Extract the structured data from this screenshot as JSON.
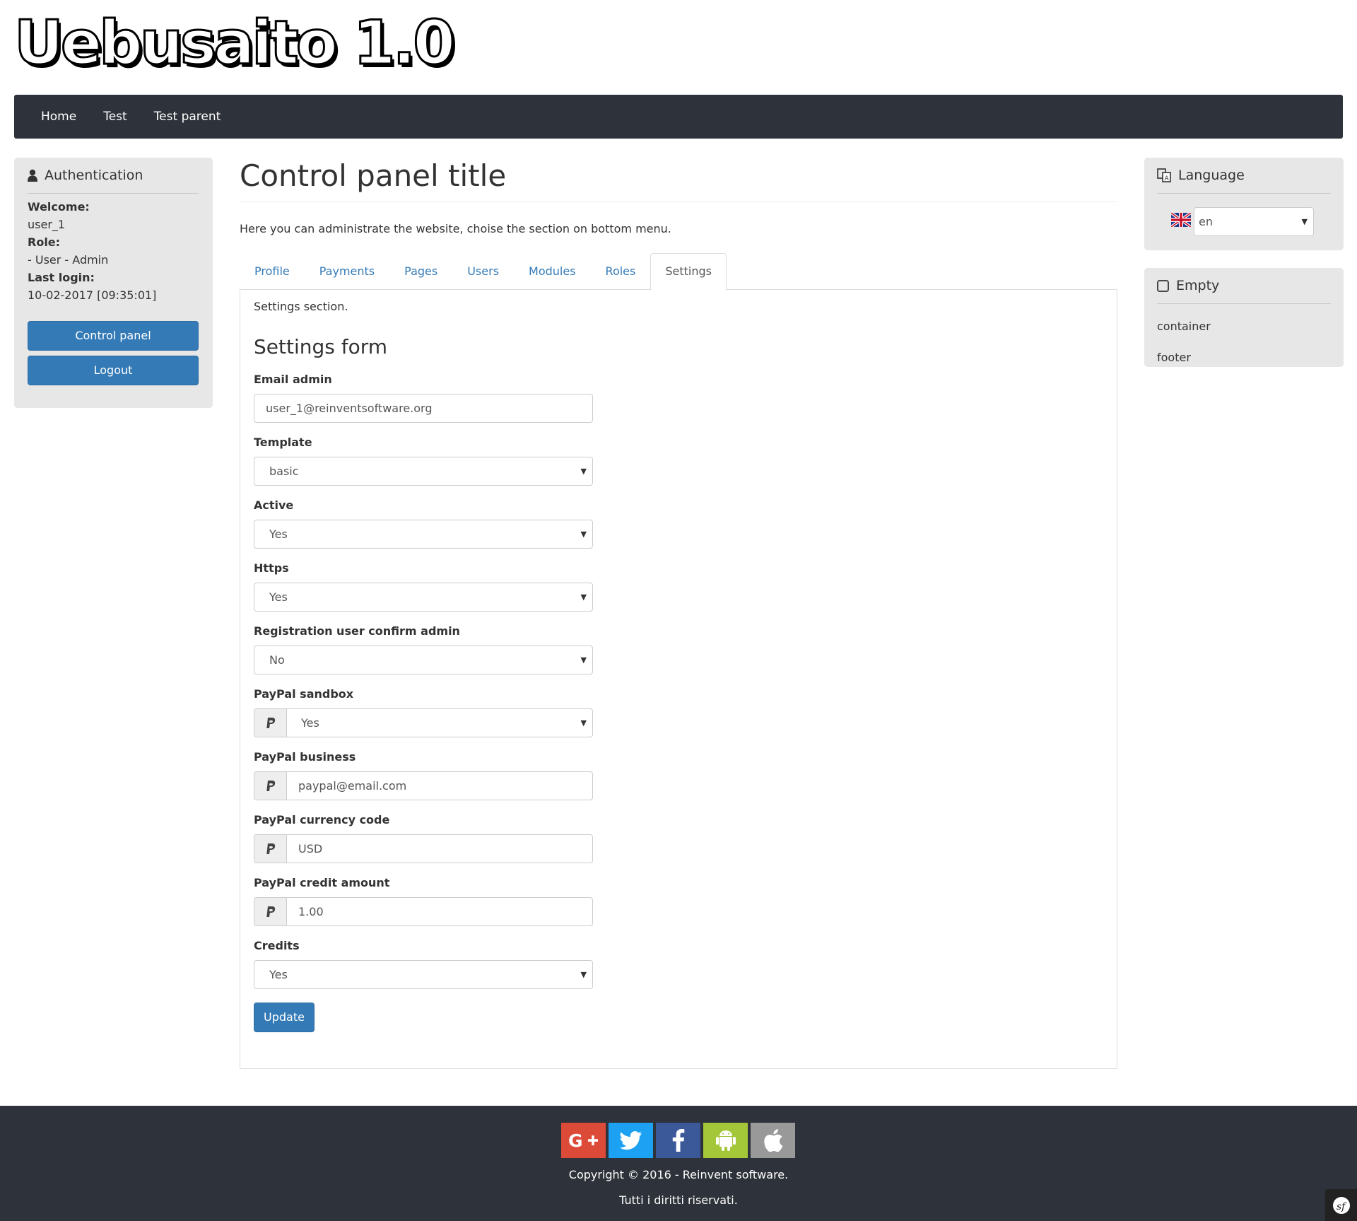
{
  "site": {
    "logo_text": "Uebusaito 1.0"
  },
  "nav": {
    "items": [
      {
        "label": "Home"
      },
      {
        "label": "Test"
      },
      {
        "label": "Test parent"
      }
    ]
  },
  "auth": {
    "title": "Authentication",
    "welcome_label": "Welcome:",
    "welcome_value": "user_1",
    "role_label": "Role:",
    "role_value": "- User - Admin",
    "last_login_label": "Last login:",
    "last_login_value": "10-02-2017 [09:35:01]",
    "control_panel_label": "Control panel",
    "logout_label": "Logout"
  },
  "main": {
    "title": "Control panel title",
    "intro": "Here you can administrate the website, choise the section on bottom menu.",
    "tabs": [
      {
        "label": "Profile"
      },
      {
        "label": "Payments"
      },
      {
        "label": "Pages"
      },
      {
        "label": "Users"
      },
      {
        "label": "Modules"
      },
      {
        "label": "Roles"
      },
      {
        "label": "Settings",
        "active": true
      }
    ],
    "section_text": "Settings section.",
    "form": {
      "title": "Settings form",
      "fields": {
        "email_admin": {
          "label": "Email admin",
          "value": "user_1@reinventsoftware.org"
        },
        "template": {
          "label": "Template",
          "value": "basic"
        },
        "active": {
          "label": "Active",
          "value": "Yes"
        },
        "https": {
          "label": "Https",
          "value": "Yes"
        },
        "registration": {
          "label": "Registration user confirm admin",
          "value": "No"
        },
        "paypal_sandbox": {
          "label": "PayPal sandbox",
          "value": "Yes"
        },
        "paypal_business": {
          "label": "PayPal business",
          "value": "paypal@email.com"
        },
        "paypal_currency": {
          "label": "PayPal currency code",
          "value": "USD"
        },
        "paypal_credit": {
          "label": "PayPal credit amount",
          "value": "1.00"
        },
        "credits": {
          "label": "Credits",
          "value": "Yes"
        }
      },
      "submit_label": "Update"
    }
  },
  "language": {
    "title": "Language",
    "selected": "en"
  },
  "empty_panel": {
    "title": "Empty",
    "items": [
      {
        "label": "container"
      },
      {
        "label": "footer"
      }
    ]
  },
  "footer": {
    "copyright": "Copyright © 2016 - Reinvent software.",
    "rights": "Tutti i diritti riservati.",
    "social": [
      {
        "name": "google-plus-icon",
        "color": "#dc4a38"
      },
      {
        "name": "twitter-icon",
        "color": "#1da1f2"
      },
      {
        "name": "facebook-icon",
        "color": "#3b5998"
      },
      {
        "name": "android-icon",
        "color": "#a4c639"
      },
      {
        "name": "apple-icon",
        "color": "#999999"
      }
    ]
  },
  "colors": {
    "navbar": "#2e323a",
    "primary": "#337ab7",
    "panel": "#e7e7e7",
    "link": "#337ab7"
  }
}
